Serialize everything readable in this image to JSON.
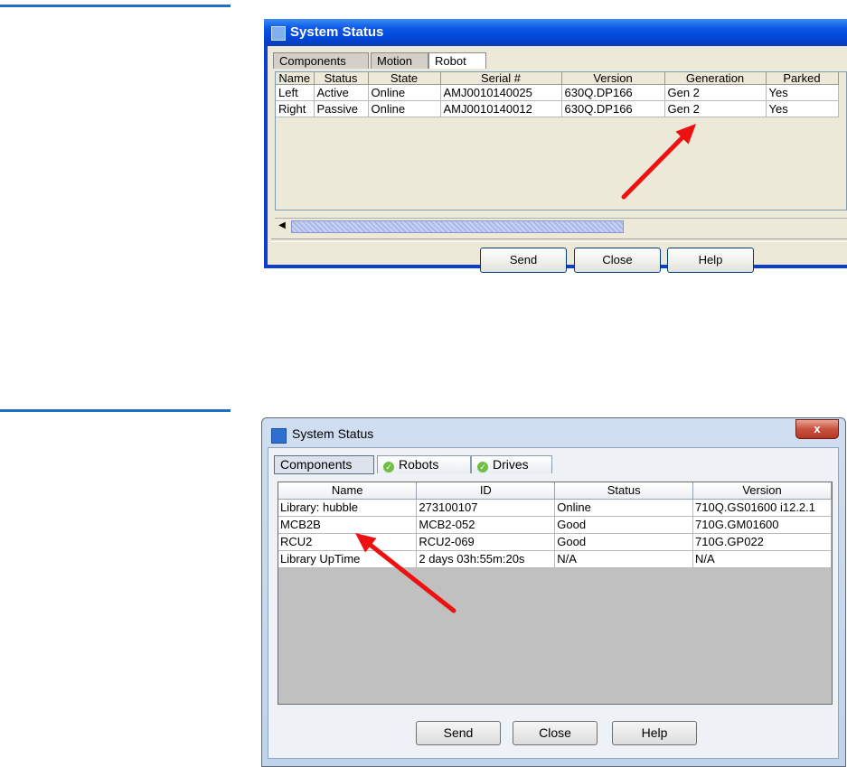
{
  "window1": {
    "title": "System Status",
    "tabs": [
      {
        "label": "Components"
      },
      {
        "label": "Motion"
      },
      {
        "label": "Robot"
      }
    ],
    "columns": [
      "Name",
      "Status",
      "State",
      "Serial #",
      "Version",
      "Generation",
      "Parked"
    ],
    "rows": [
      [
        "Left",
        "Active",
        "Online",
        "AMJ0010140025",
        "630Q.DP166",
        "Gen 2",
        "Yes"
      ],
      [
        "Right",
        "Passive",
        "Online",
        "AMJ0010140012",
        "630Q.DP166",
        "Gen 2",
        "Yes"
      ]
    ],
    "buttons": {
      "send": "Send",
      "close": "Close",
      "help": "Help"
    },
    "titlebar_color": "#0046d8",
    "icons": {
      "scroll_left": "◀"
    }
  },
  "window2": {
    "title": "System Status",
    "close_glyph": "x",
    "tabs": [
      {
        "label": "Components"
      },
      {
        "label": "Robots",
        "icon": "check-circle-icon"
      },
      {
        "label": "Drives",
        "icon": "check-circle-icon"
      }
    ],
    "columns": [
      "Name",
      "ID",
      "Status",
      "Version"
    ],
    "rows": [
      [
        "Library: hubble",
        "273100107",
        "Online",
        "710Q.GS01600 i12.2.1"
      ],
      [
        "MCB2B",
        "MCB2-052",
        "Good",
        "710G.GM01600"
      ],
      [
        "RCU2",
        "RCU2-069",
        "Good",
        "710G.GP022"
      ],
      [
        "Library UpTime",
        "2 days 03h:55m:20s",
        "N/A",
        "N/A"
      ]
    ],
    "buttons": {
      "send": "Send",
      "close": "Close",
      "help": "Help"
    },
    "status_icon_color": "#6fbf44"
  },
  "annotation_color": "#ee1111"
}
